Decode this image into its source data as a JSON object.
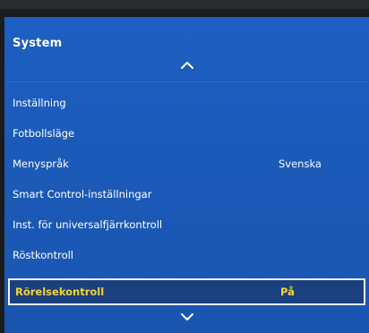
{
  "panel": {
    "title": "System",
    "scroll_up_icon": "chevron-up-icon",
    "scroll_down_icon": "chevron-down-icon"
  },
  "menu": {
    "items": [
      {
        "label": "Inställning",
        "value": ""
      },
      {
        "label": "Fotbollsläge",
        "value": ""
      },
      {
        "label": "Menyspråk",
        "value": "Svenska"
      },
      {
        "label": "Smart Control-inställningar",
        "value": ""
      },
      {
        "label": "Inst. för universalfjärrkontroll",
        "value": ""
      },
      {
        "label": "Röstkontroll",
        "value": ""
      },
      {
        "label": "Rörelsekontroll",
        "value": "På",
        "selected": true
      }
    ]
  },
  "colors": {
    "panel_blue": "#1c5ab8",
    "highlight_text": "#f3d43a",
    "selected_bg": "#1c3f7d",
    "selected_border": "#f3f3f3"
  }
}
